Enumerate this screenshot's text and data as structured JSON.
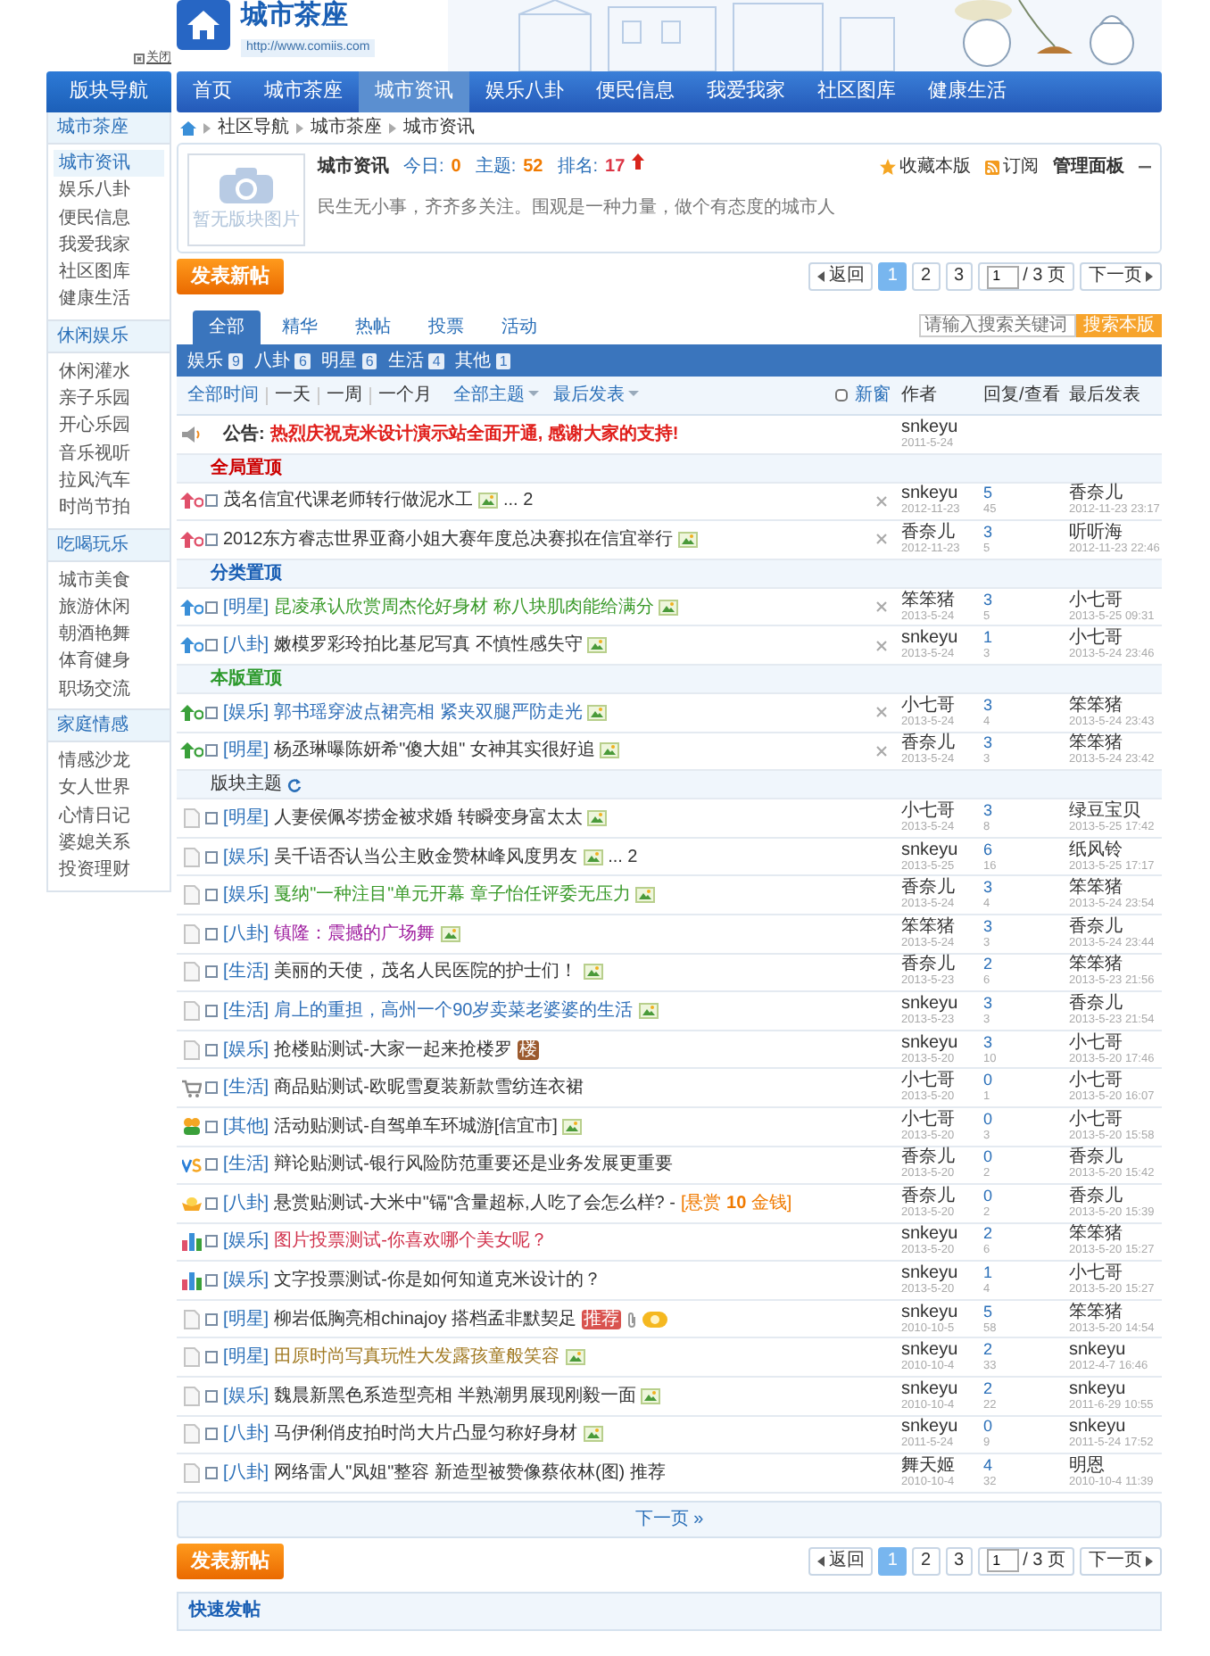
{
  "header": {
    "site_title": "城市茶座",
    "url": "http://www.comiis.com",
    "close_link": "关闭"
  },
  "sidebar": {
    "title": "版块导航",
    "groups": [
      {
        "name": "城市茶座",
        "items": [
          {
            "label": "城市资讯",
            "selected": true
          },
          {
            "label": "娱乐八卦",
            "selected": false
          },
          {
            "label": "便民信息",
            "selected": false
          },
          {
            "label": "我爱我家",
            "selected": false
          },
          {
            "label": "社区图库",
            "selected": false
          },
          {
            "label": "健康生活",
            "selected": false
          }
        ]
      },
      {
        "name": "休闲娱乐",
        "items": [
          {
            "label": "休闲灌水",
            "selected": false
          },
          {
            "label": "亲子乐园",
            "selected": false
          },
          {
            "label": "开心乐园",
            "selected": false
          },
          {
            "label": "音乐视听",
            "selected": false
          },
          {
            "label": "拉风汽车",
            "selected": false
          },
          {
            "label": "时尚节拍",
            "selected": false
          }
        ]
      },
      {
        "name": "吃喝玩乐",
        "items": [
          {
            "label": "城市美食",
            "selected": false
          },
          {
            "label": "旅游休闲",
            "selected": false
          },
          {
            "label": "朝酒艳舞",
            "selected": false
          },
          {
            "label": "体育健身",
            "selected": false
          },
          {
            "label": "职场交流",
            "selected": false
          }
        ]
      },
      {
        "name": "家庭情感",
        "items": [
          {
            "label": "情感沙龙",
            "selected": false
          },
          {
            "label": "女人世界",
            "selected": false
          },
          {
            "label": "心情日记",
            "selected": false
          },
          {
            "label": "婆媳关系",
            "selected": false
          },
          {
            "label": "投资理财",
            "selected": false
          }
        ]
      }
    ]
  },
  "nav": {
    "items": [
      {
        "label": "首页",
        "selected": false
      },
      {
        "label": "城市茶座",
        "selected": false
      },
      {
        "label": "城市资讯",
        "selected": true
      },
      {
        "label": "娱乐八卦",
        "selected": false
      },
      {
        "label": "便民信息",
        "selected": false
      },
      {
        "label": "我爱我家",
        "selected": false
      },
      {
        "label": "社区图库",
        "selected": false
      },
      {
        "label": "健康生活",
        "selected": false
      }
    ]
  },
  "breadcrumb": [
    "社区导航",
    "城市茶座",
    "城市资讯"
  ],
  "forum": {
    "image_caption": "暂无版块图片",
    "name": "城市资讯",
    "stats": [
      {
        "label": "今日:",
        "value": "0"
      },
      {
        "label": "主题:",
        "value": "52"
      },
      {
        "label": "排名:",
        "value": "17"
      }
    ],
    "description": "民生无小事，齐齐多关注。围观是一种力量，做个有态度的城市人",
    "actions": [
      "收藏本版",
      "订阅",
      "管理面板"
    ]
  },
  "post_button_top": "发表新帖",
  "pagination_top": {
    "back": "返回",
    "pages": [
      {
        "label": "1",
        "selected": true
      },
      {
        "label": "2",
        "selected": false
      },
      {
        "label": "3",
        "selected": false
      }
    ],
    "page_input": "1",
    "total": "/ 3 页",
    "next": "下一页"
  },
  "tabs": [
    {
      "label": "全部",
      "selected": true
    },
    {
      "label": "精华",
      "selected": false
    },
    {
      "label": "热帖",
      "selected": false
    },
    {
      "label": "投票",
      "selected": false
    },
    {
      "label": "活动",
      "selected": false
    }
  ],
  "search": {
    "placeholder": "请输入搜索关键词",
    "button": "搜索本版"
  },
  "categories": [
    {
      "label": "娱乐",
      "count": "9"
    },
    {
      "label": "八卦",
      "count": "6"
    },
    {
      "label": "明星",
      "count": "6"
    },
    {
      "label": "生活",
      "count": "4"
    },
    {
      "label": "其他",
      "count": "1"
    }
  ],
  "filters": {
    "times": [
      {
        "label": "全部时间",
        "selected": true
      },
      {
        "label": "一天",
        "selected": false
      },
      {
        "label": "一周",
        "selected": false
      },
      {
        "label": "一个月",
        "selected": false
      }
    ],
    "dropdowns": [
      "全部主题",
      "最后发表"
    ],
    "new_window": {
      "label": "新窗",
      "checked": false
    },
    "columns": [
      "作者",
      "回复/查看",
      "最后发表"
    ]
  },
  "rows": [
    {
      "kind": "announcement",
      "label": "公告:",
      "text": "热烈庆祝克米设计演示站全面开通, 感谢大家的支持!",
      "author": "snkeyu",
      "date": "2011-5-24"
    },
    {
      "kind": "section",
      "title": "全局置顶",
      "color": "#cc0000"
    },
    {
      "kind": "pinned-global",
      "title": "茂名信宜代课老师转行做泥水工",
      "color": "#333333",
      "extras": [
        {
          "kind": "image"
        }
      ],
      "pages": "... 2",
      "closable": true,
      "author": "snkeyu",
      "date": "2012-11-23",
      "replies": "5",
      "views": "45",
      "last_user": "香奈儿",
      "last_time": "2012-11-23 23:17"
    },
    {
      "kind": "pinned-global",
      "title": "2012东方睿志世界亚裔小姐大赛年度总决赛拟在信宜举行",
      "color": "#333333",
      "extras": [
        {
          "kind": "image"
        }
      ],
      "closable": true,
      "author": "香奈儿",
      "date": "2012-11-23",
      "replies": "3",
      "views": "5",
      "last_user": "听听海",
      "last_time": "2012-11-23 22:46"
    },
    {
      "kind": "section",
      "title": "分类置顶",
      "color": "#1a5fb4"
    },
    {
      "kind": "pinned-category",
      "category": "[明星]",
      "title": "昆凌承认欣赏周杰伦好身材 称八块肌肉能给满分",
      "color": "#3a9a2a",
      "extras": [
        {
          "kind": "image"
        }
      ],
      "closable": true,
      "author": "笨笨猪",
      "date": "2013-5-24",
      "replies": "3",
      "views": "5",
      "last_user": "小七哥",
      "last_time": "2013-5-25 09:31"
    },
    {
      "kind": "pinned-category",
      "category": "[八卦]",
      "title": "嫩模罗彩玲拍比基尼写真 不慎性感失守",
      "color": "#333333",
      "extras": [
        {
          "kind": "image"
        }
      ],
      "closable": true,
      "author": "snkeyu",
      "date": "2013-5-24",
      "replies": "1",
      "views": "3",
      "last_user": "小七哥",
      "last_time": "2013-5-24 23:46"
    },
    {
      "kind": "section",
      "title": "本版置顶",
      "color": "#2e9a2e"
    },
    {
      "kind": "pinned-forum",
      "category": "[娱乐]",
      "title": "郭书瑶穿波点裙亮相 紧夹双腿严防走光",
      "color": "#2f6fb8",
      "extras": [
        {
          "kind": "image"
        }
      ],
      "closable": true,
      "author": "小七哥",
      "date": "2013-5-24",
      "replies": "3",
      "views": "4",
      "last_user": "笨笨猪",
      "last_time": "2013-5-24 23:43"
    },
    {
      "kind": "pinned-forum",
      "category": "[明星]",
      "title": "杨丞琳曝陈妍希\"傻大姐\" 女神其实很好追",
      "color": "#333333",
      "extras": [
        {
          "kind": "image"
        }
      ],
      "closable": true,
      "author": "香奈儿",
      "date": "2013-5-24",
      "replies": "3",
      "views": "3",
      "last_user": "笨笨猪",
      "last_time": "2013-5-24 23:42"
    },
    {
      "kind": "section",
      "title": "版块主题",
      "color": "#333333",
      "refresh": true
    },
    {
      "kind": "topic",
      "category": "[明星]",
      "title": "人妻侯佩岑捞金被求婚 转瞬变身富太太",
      "color": "#333333",
      "extras": [
        {
          "kind": "image"
        }
      ],
      "author": "小七哥",
      "date": "2013-5-24",
      "replies": "3",
      "views": "8",
      "last_user": "绿豆宝贝",
      "last_time": "2013-5-25 17:42"
    },
    {
      "kind": "topic",
      "category": "[娱乐]",
      "title": "吴千语否认当公主败金赞林峰风度男友",
      "color": "#333333",
      "extras": [
        {
          "kind": "image"
        }
      ],
      "pages": "... 2",
      "author": "snkeyu",
      "date": "2013-5-25",
      "replies": "6",
      "views": "16",
      "last_user": "纸风铃",
      "last_time": "2013-5-25 17:17"
    },
    {
      "kind": "topic",
      "category": "[娱乐]",
      "title": "戛纳\"一种注目\"单元开幕 章子怡任评委无压力",
      "color": "#3a9a2a",
      "extras": [
        {
          "kind": "image"
        }
      ],
      "author": "香奈儿",
      "date": "2013-5-24",
      "replies": "3",
      "views": "4",
      "last_user": "笨笨猪",
      "last_time": "2013-5-24 23:54"
    },
    {
      "kind": "topic",
      "category": "[八卦]",
      "title": "镇隆：震撼的广场舞",
      "color": "#a020a0",
      "extras": [
        {
          "kind": "image"
        }
      ],
      "author": "笨笨猪",
      "date": "2013-5-24",
      "replies": "3",
      "views": "3",
      "last_user": "香奈儿",
      "last_time": "2013-5-24 23:44"
    },
    {
      "kind": "topic",
      "category": "[生活]",
      "title": "美丽的天使，茂名人民医院的护士们！",
      "color": "#333333",
      "extras": [
        {
          "kind": "image"
        }
      ],
      "author": "香奈儿",
      "date": "2013-5-23",
      "replies": "2",
      "views": "6",
      "last_user": "笨笨猪",
      "last_time": "2013-5-23 21:56"
    },
    {
      "kind": "topic",
      "category": "[生活]",
      "title": "肩上的重担，高州一个90岁卖菜老婆婆的生活",
      "color": "#2f6fb8",
      "extras": [
        {
          "kind": "image"
        }
      ],
      "author": "snkeyu",
      "date": "2013-5-23",
      "replies": "3",
      "views": "3",
      "last_user": "香奈儿",
      "last_time": "2013-5-23 21:54"
    },
    {
      "kind": "topic",
      "category": "[娱乐]",
      "title": "抢楼贴测试-大家一起来抢楼罗",
      "color": "#333333",
      "extras": [
        {
          "kind": "badge",
          "text": "楼",
          "color": "#9b5a2e"
        }
      ],
      "author": "snkeyu",
      "date": "2013-5-20",
      "replies": "3",
      "views": "10",
      "last_user": "小七哥",
      "last_time": "2013-5-20 17:46"
    },
    {
      "kind": "goods",
      "category": "[生活]",
      "title": "商品贴测试-欧昵雪夏装新款雪纺连衣裙",
      "color": "#333333",
      "author": "小七哥",
      "date": "2013-5-20",
      "replies": "0",
      "views": "1",
      "last_user": "小七哥",
      "last_time": "2013-5-20 16:07"
    },
    {
      "kind": "activity",
      "category": "[其他]",
      "title": "活动贴测试-自驾单车环城游[信宜市]",
      "color": "#333333",
      "extras": [
        {
          "kind": "image"
        }
      ],
      "author": "小七哥",
      "date": "2013-5-20",
      "replies": "0",
      "views": "3",
      "last_user": "小七哥",
      "last_time": "2013-5-20 15:58"
    },
    {
      "kind": "debate",
      "category": "[生活]",
      "title": "辩论贴测试-银行风险防范重要还是业务发展更重要",
      "color": "#333333",
      "author": "香奈儿",
      "date": "2013-5-20",
      "replies": "0",
      "views": "2",
      "last_user": "香奈儿",
      "last_time": "2013-5-20 15:42"
    },
    {
      "kind": "reward",
      "category": "[八卦]",
      "title": "悬赏贴测试-大米中\"镉\"含量超标,人吃了会怎么样? -",
      "color": "#333333",
      "reward": "[悬赏 **10** 金钱]",
      "author": "香奈儿",
      "date": "2013-5-20",
      "replies": "0",
      "views": "2",
      "last_user": "香奈儿",
      "last_time": "2013-5-20 15:39"
    },
    {
      "kind": "poll",
      "category": "[娱乐]",
      "title": "图片投票测试-你喜欢哪个美女呢？",
      "color": "#d0304a",
      "author": "snkeyu",
      "date": "2013-5-20",
      "replies": "2",
      "views": "6",
      "last_user": "笨笨猪",
      "last_time": "2013-5-20 15:27"
    },
    {
      "kind": "poll",
      "category": "[娱乐]",
      "title": "文字投票测试-你是如何知道克米设计的？",
      "color": "#333333",
      "author": "snkeyu",
      "date": "2013-5-20",
      "replies": "1",
      "views": "4",
      "last_user": "小七哥",
      "last_time": "2013-5-20 15:27"
    },
    {
      "kind": "topic",
      "category": "[明星]",
      "title": "柳岩低胸亮相chinajoy 搭档孟非默契足",
      "color": "#333333",
      "extras": [
        {
          "kind": "badge",
          "text": "推荐",
          "color": "#d9534f"
        },
        {
          "kind": "clip"
        },
        {
          "kind": "hot"
        }
      ],
      "author": "snkeyu",
      "date": "2010-10-5",
      "replies": "5",
      "views": "58",
      "last_user": "笨笨猪",
      "last_time": "2013-5-20 14:54"
    },
    {
      "kind": "topic",
      "category": "[明星]",
      "title": "田原时尚写真玩性大发露孩童般笑容",
      "color": "#a07820",
      "extras": [
        {
          "kind": "image"
        }
      ],
      "author": "snkeyu",
      "date": "2010-10-4",
      "replies": "2",
      "views": "33",
      "last_user": "snkeyu",
      "last_time": "2012-4-7 16:46"
    },
    {
      "kind": "topic",
      "category": "[娱乐]",
      "title": "魏晨新黑色系造型亮相 半熟潮男展现刚毅一面",
      "color": "#333333",
      "extras": [
        {
          "kind": "image"
        }
      ],
      "author": "snkeyu",
      "date": "2010-10-4",
      "replies": "2",
      "views": "22",
      "last_user": "snkeyu",
      "last_time": "2011-6-29 10:55"
    },
    {
      "kind": "topic",
      "category": "[八卦]",
      "title": "马伊俐俏皮拍时尚大片凸显匀称好身材",
      "color": "#333333",
      "extras": [
        {
          "kind": "image"
        }
      ],
      "author": "snkeyu",
      "date": "2011-5-24",
      "replies": "0",
      "views": "9",
      "last_user": "snkeyu",
      "last_time": "2011-5-24 17:52"
    },
    {
      "kind": "topic",
      "category": "[八卦]",
      "title": "网络雷人\"凤姐\"整容 新造型被赞像蔡依林(图) 推荐",
      "color": "#333333",
      "author": "舞天姬",
      "date": "2010-10-4",
      "replies": "4",
      "views": "32",
      "last_user": "明恩",
      "last_time": "2010-10-4 11:39"
    }
  ],
  "next_page": "下一页 »",
  "post_button_bottom": "发表新帖",
  "pagination_bottom": {
    "back": "返回",
    "pages": [
      {
        "label": "1",
        "selected": true
      },
      {
        "label": "2",
        "selected": false
      },
      {
        "label": "3",
        "selected": false
      }
    ],
    "page_input": "1",
    "total": "/ 3 页",
    "next": "下一页"
  },
  "quick_post": "快速发帖"
}
